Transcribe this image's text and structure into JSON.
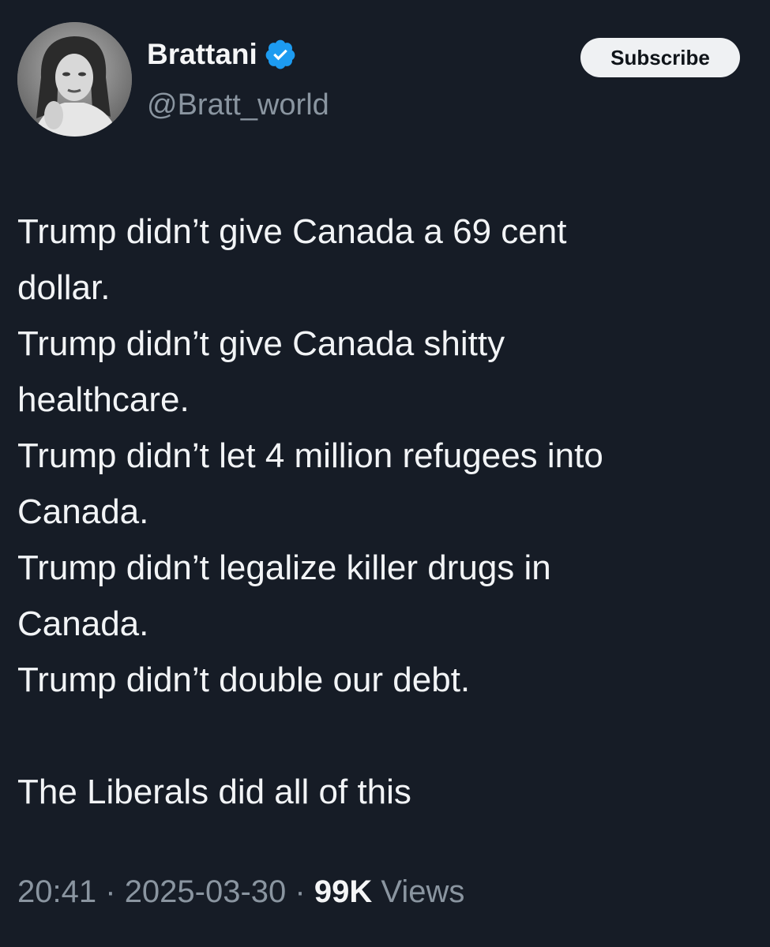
{
  "colors": {
    "background": "#161c26",
    "text": "#f2f4f6",
    "secondary_text": "#8a95a0",
    "verified_badge": "#1d9bf0",
    "subscribe_bg": "#eff1f3"
  },
  "author": {
    "display_name": "Brattani",
    "handle": "@Bratt_world",
    "avatar_icon": "profile-photo",
    "verified_icon": "verified-badge-icon"
  },
  "subscribe_label": "Subscribe",
  "tweet": {
    "lines": [
      "Trump didn’t give Canada a 69 cent",
      "dollar.",
      "Trump didn’t give Canada shitty",
      "healthcare.",
      "Trump didn’t let 4 million refugees into",
      "Canada.",
      "Trump didn’t legalize killer drugs in",
      "Canada.",
      "Trump didn’t double our debt."
    ],
    "closing": "The Liberals did all of this"
  },
  "meta": {
    "time": "20:41",
    "separator": "·",
    "date": "2025-03-30",
    "views_count": "99K",
    "views_label": "Views"
  }
}
